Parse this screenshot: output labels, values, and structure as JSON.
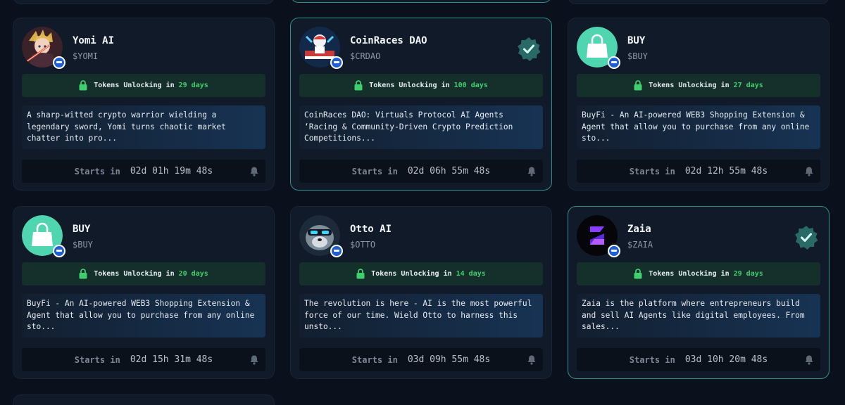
{
  "cards": [
    {
      "name": "Yomi AI",
      "ticker": "$YOMI",
      "unlock_label": "Tokens Unlocking in",
      "unlock_days": "29 days",
      "description": "A sharp-witted crypto warrior wielding a legendary sword, Yomi turns chaotic market chatter into pro...",
      "starts_label": "Starts in",
      "countdown": "02d 01h 19m 48s",
      "verified": false,
      "avatar_icon": "anime-warrior-avatar"
    },
    {
      "name": "CoinRaces DAO",
      "ticker": "$CRDAO",
      "unlock_label": "Tokens Unlocking in",
      "unlock_days": "100 days",
      "description": "CoinRaces DAO: Virtuals Protocol AI Agents ‘Racing & Community-Driven Crypto Prediction Competitions...",
      "starts_label": "Starts in",
      "countdown": "02d 06h 55m 48s",
      "verified": true,
      "avatar_icon": "racer-avatar"
    },
    {
      "name": "BUY",
      "ticker": "$BUY",
      "unlock_label": "Tokens Unlocking in",
      "unlock_days": "27 days",
      "description": "BuyFi - An AI-powered WEB3 Shopping Extension & Agent that allow you to purchase from any online sto...",
      "starts_label": "Starts in",
      "countdown": "02d 12h 55m 48s",
      "verified": false,
      "avatar_icon": "shopping-bag-avatar"
    },
    {
      "name": "BUY",
      "ticker": "$BUY",
      "unlock_label": "Tokens Unlocking in",
      "unlock_days": "20 days",
      "description": "BuyFi - An AI-powered WEB3 Shopping Extension & Agent that allow you to purchase from any online sto...",
      "starts_label": "Starts in",
      "countdown": "02d 15h 31m 48s",
      "verified": false,
      "avatar_icon": "shopping-bag-avatar"
    },
    {
      "name": "Otto AI",
      "ticker": "$OTTO",
      "unlock_label": "Tokens Unlocking in",
      "unlock_days": "14 days",
      "description": "The revolution is here - AI is the most powerful force of our time. Wield Otto to harness this unsto...",
      "starts_label": "Starts in",
      "countdown": "03d 09h 55m 48s",
      "verified": false,
      "avatar_icon": "otter-avatar"
    },
    {
      "name": "Zaia",
      "ticker": "$ZAIA",
      "unlock_label": "Tokens Unlocking in",
      "unlock_days": "29 days",
      "description": "Zaia is the platform where entrepreneurs build and sell AI Agents like digital employees. From sales...",
      "starts_label": "Starts in",
      "countdown": "03d 10h 20m 48s",
      "verified": true,
      "avatar_icon": "zaia-logo-avatar"
    }
  ],
  "colors": {
    "background": "#0a111c",
    "card": "#111a28",
    "highlight_border": "#2f8f8a",
    "unlock_bg": "#15302b",
    "days_green": "#3fcf6f",
    "verified_badge": "#2a6a66",
    "bag_green": "#4fd6b0"
  }
}
